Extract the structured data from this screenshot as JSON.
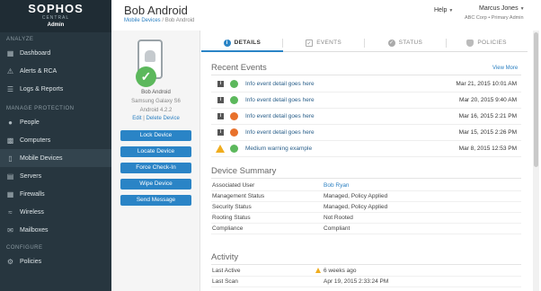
{
  "brand": {
    "logo": "SOPHOS",
    "sub": "CENTRAL",
    "role": "Admin"
  },
  "sidebar": {
    "sections": [
      {
        "label": "ANALYZE",
        "items": [
          {
            "label": "Dashboard",
            "icon": "grid-icon"
          },
          {
            "label": "Alerts & RCA",
            "icon": "warning-icon"
          },
          {
            "label": "Logs & Reports",
            "icon": "list-icon"
          }
        ]
      },
      {
        "label": "MANAGE PROTECTION",
        "items": [
          {
            "label": "People",
            "icon": "people-icon"
          },
          {
            "label": "Computers",
            "icon": "computer-icon"
          },
          {
            "label": "Mobile Devices",
            "icon": "mobile-icon",
            "active": true
          },
          {
            "label": "Servers",
            "icon": "server-icon"
          },
          {
            "label": "Firewalls",
            "icon": "firewall-icon"
          },
          {
            "label": "Wireless",
            "icon": "wireless-icon"
          },
          {
            "label": "Mailboxes",
            "icon": "mailbox-icon"
          }
        ]
      },
      {
        "label": "CONFIGURE",
        "items": [
          {
            "label": "Policies",
            "icon": "policy-icon"
          }
        ]
      }
    ]
  },
  "header": {
    "title": "Bob Android",
    "breadcrumb": {
      "parent": "Mobile Devices",
      "separator": " / ",
      "current": "Bob Android"
    },
    "help": "Help",
    "user": {
      "name": "Marcus Jones",
      "sub": "ABC Corp • Primary Admin"
    }
  },
  "device": {
    "name": "Bob Android",
    "model": "Samsung Galaxy S6",
    "os": "Android 4.2.2",
    "edit": "Edit",
    "sep": " | ",
    "delete": "Delete Device",
    "actions": [
      "Lock Device",
      "Locate Device",
      "Force Check-In",
      "Wipe Device",
      "Send Message"
    ]
  },
  "tabs": [
    {
      "label": "DETAILS",
      "icon": "info-icon",
      "active": true
    },
    {
      "label": "EVENTS",
      "icon": "checkbox-icon"
    },
    {
      "label": "STATUS",
      "icon": "check-circle-icon"
    },
    {
      "label": "POLICIES",
      "icon": "shield-icon"
    }
  ],
  "recent_events": {
    "title": "Recent Events",
    "view_more": "View More",
    "rows": [
      {
        "type": "info",
        "status": "green",
        "text": "Info event detail goes here",
        "date": "Mar 21, 2015 10:01 AM"
      },
      {
        "type": "info",
        "status": "green",
        "text": "Info event detail goes here",
        "date": "Mar 20, 2015  9:40 AM"
      },
      {
        "type": "info",
        "status": "orange",
        "text": "Info event detail goes here",
        "date": "Mar 16, 2015  2:21 PM"
      },
      {
        "type": "info",
        "status": "orange",
        "text": "Info event detail goes here",
        "date": "Mar 15, 2015  2:26 PM"
      },
      {
        "type": "warning",
        "status": "green",
        "text": "Medium warning example",
        "date": "Mar 8, 2015 12:53 PM"
      }
    ]
  },
  "device_summary": {
    "title": "Device Summary",
    "rows": [
      {
        "key": "Associated User",
        "value": "Bob Ryan",
        "link": true
      },
      {
        "key": "Management Status",
        "value": "Managed, Policy Applied"
      },
      {
        "key": "Security Status",
        "value": "Managed, Policy Applied"
      },
      {
        "key": "Rooting Status",
        "value": "Not Rooted"
      },
      {
        "key": "Compliance",
        "value": "Compliant"
      }
    ]
  },
  "activity": {
    "title": "Activity",
    "rows": [
      {
        "key": "Last Active",
        "value": "6 weeks ago",
        "warn": true
      },
      {
        "key": "Last Scan",
        "value": "Apr 19, 2015 2:33:24 PM"
      }
    ]
  },
  "colors": {
    "sidebar": "#27363f",
    "accent": "#2a84c6",
    "ok": "#5cb85c",
    "warn": "#f0ad1e",
    "alert": "#e8712b"
  }
}
